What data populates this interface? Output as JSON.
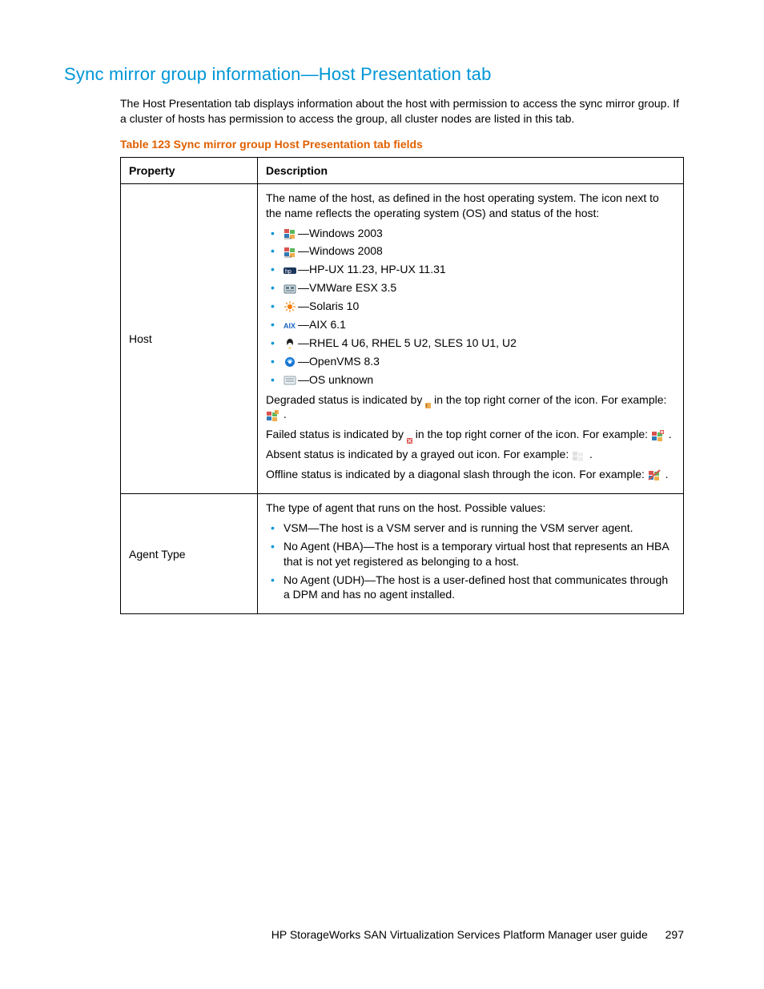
{
  "heading": "Sync mirror group information—Host Presentation tab",
  "intro": "The Host Presentation tab displays information about the host with permission to access the sync mirror group. If a cluster of hosts has permission to access the group, all cluster nodes are listed in this tab.",
  "table_caption": "Table 123 Sync mirror group Host Presentation tab fields",
  "columns": {
    "property": "Property",
    "description": "Description"
  },
  "rows": {
    "host": {
      "property": "Host",
      "lead": "The name of the host, as defined in the host operating system. The icon next to the name reflects the operating system (OS) and status of the host:",
      "items": [
        "—Windows 2003",
        "—Windows 2008",
        "—HP-UX 11.23, HP-UX 11.31",
        "—VMWare ESX 3.5",
        "—Solaris 10",
        "—AIX 6.1",
        "—RHEL 4 U6, RHEL 5 U2, SLES 10 U1, U2",
        "—OpenVMS 8.3",
        "—OS unknown"
      ],
      "status_degraded_a": "Degraded status is indicated by ",
      "status_degraded_b": " in the top right corner of the icon. For example: ",
      "status_failed_a": "Failed status is indicated by ",
      "status_failed_b": " in the top right corner of the icon. For example: ",
      "status_absent_a": "Absent status is indicated by a grayed out icon. For example: ",
      "status_offline_a": "Offline status is indicated by a diagonal slash through the icon. For example: ",
      "period": " ."
    },
    "agent": {
      "property": "Agent Type",
      "lead": "The type of agent that runs on the host. Possible values:",
      "items": [
        "VSM—The host is a VSM server and is running the VSM server agent.",
        "No Agent (HBA)—The host is a temporary virtual host that represents an HBA that is not yet registered as belonging to a host.",
        "No Agent (UDH)—The host is a user-defined host that communicates through a DPM and has no agent installed."
      ]
    }
  },
  "footer": {
    "title": "HP StorageWorks SAN Virtualization Services Platform Manager user guide",
    "page": "297"
  }
}
